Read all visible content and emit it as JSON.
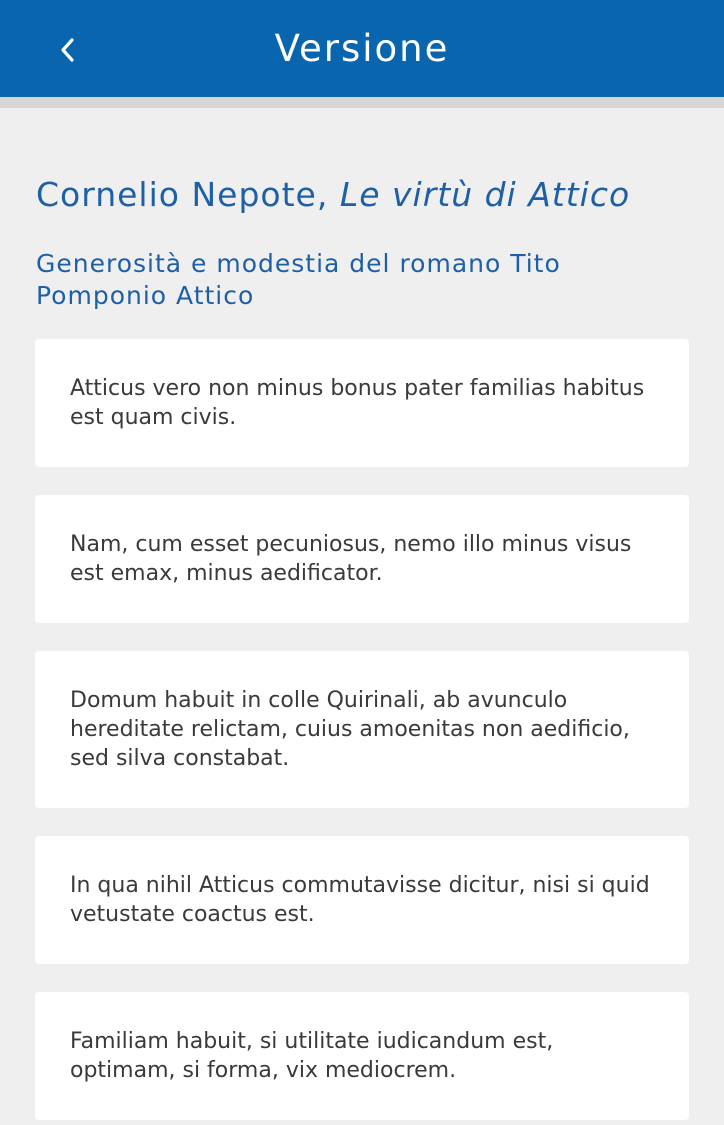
{
  "header": {
    "title": "Versione",
    "back_icon": "chevron-left-icon",
    "background": "#0966ae"
  },
  "page": {
    "author": "Cornelio Nepote,",
    "work": "Le virtù di Attico",
    "subtitle": "Generosità e modestia del romano Tito Pomponio Attico",
    "accent_color": "#1f5fa6"
  },
  "sentences": [
    "Atticus vero non minus bonus pater familias habitus est quam civis.",
    "Nam, cum esset pecuniosus, nemo illo minus visus est emax, minus aedificator.",
    "Domum habuit in colle Quirinali, ab avunculo hereditate relictam, cuius amoenitas non aedificio, sed silva constabat.",
    "In qua nihil Atticus commutavisse dicitur, nisi si quid vetustate coactus est.",
    "Familiam habuit, si utilitate iudicandum est, optimam, si forma, vix mediocrem."
  ]
}
